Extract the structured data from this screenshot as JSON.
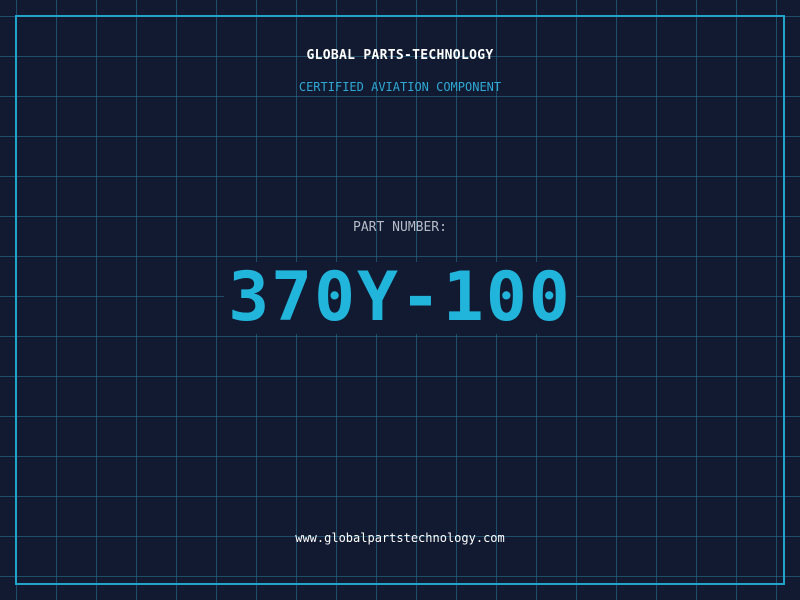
{
  "header": {
    "company": "GLOBAL PARTS-TECHNOLOGY",
    "subtitle": "CERTIFIED AVIATION COMPONENT"
  },
  "part": {
    "label": "PART NUMBER:",
    "number": "370Y-100"
  },
  "footer": {
    "url": "www.globalpartstechnology.com"
  },
  "colors": {
    "background": "#111a31",
    "grid": "#28789a",
    "accent": "#22b5dc",
    "frame": "#23a3c9"
  }
}
